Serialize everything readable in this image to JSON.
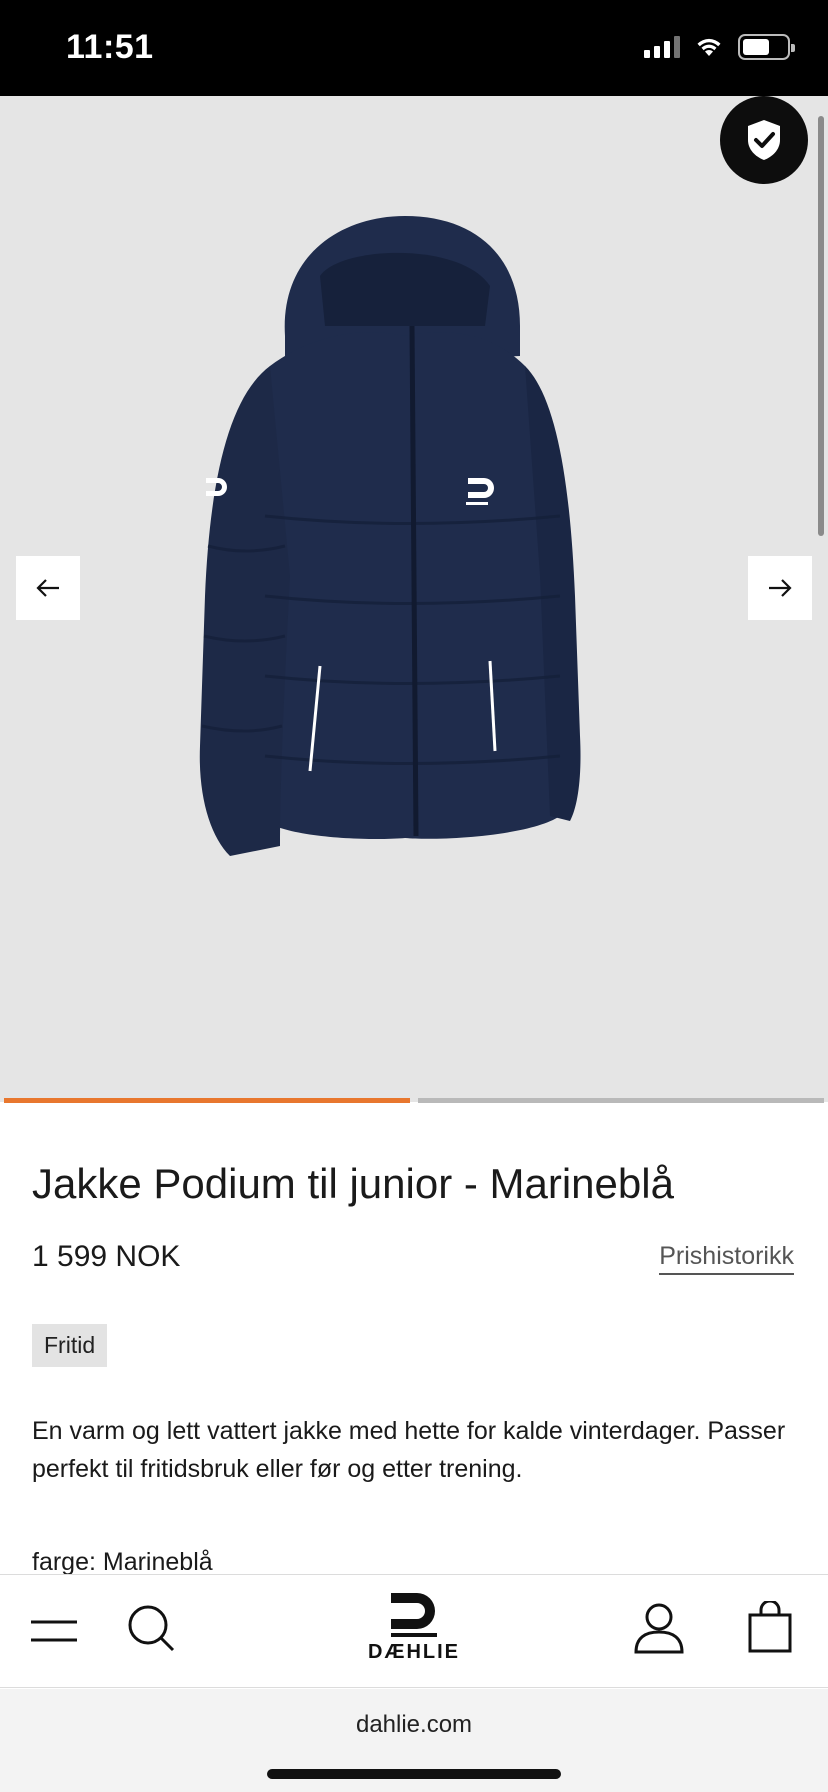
{
  "status_bar": {
    "time": "11:51"
  },
  "product": {
    "title": "Jakke Podium til junior - Marineblå",
    "price": "1 599 NOK",
    "price_history_label": "Prishistorikk",
    "tag": "Fritid",
    "description": "En varm og lett vattert jakke med hette for kalde vinterdager. Passer perfekt til fritidsbruk eller før og etter trening.",
    "color_line": "farge: Marineblå",
    "jacket_brand_mark": "DÆHLIE"
  },
  "gallery": {
    "active_index": 1,
    "total": 2,
    "progress_color": "#e8772e"
  },
  "nav": {
    "logo_text": "DÆHLIE",
    "icons": [
      "menu-icon",
      "search-icon",
      "account-icon",
      "bag-icon"
    ]
  },
  "browser": {
    "url": "dahlie.com"
  },
  "colors": {
    "hero_bg": "#e5e5e5",
    "jacket": "#1c2a4a",
    "accent": "#e8772e"
  }
}
